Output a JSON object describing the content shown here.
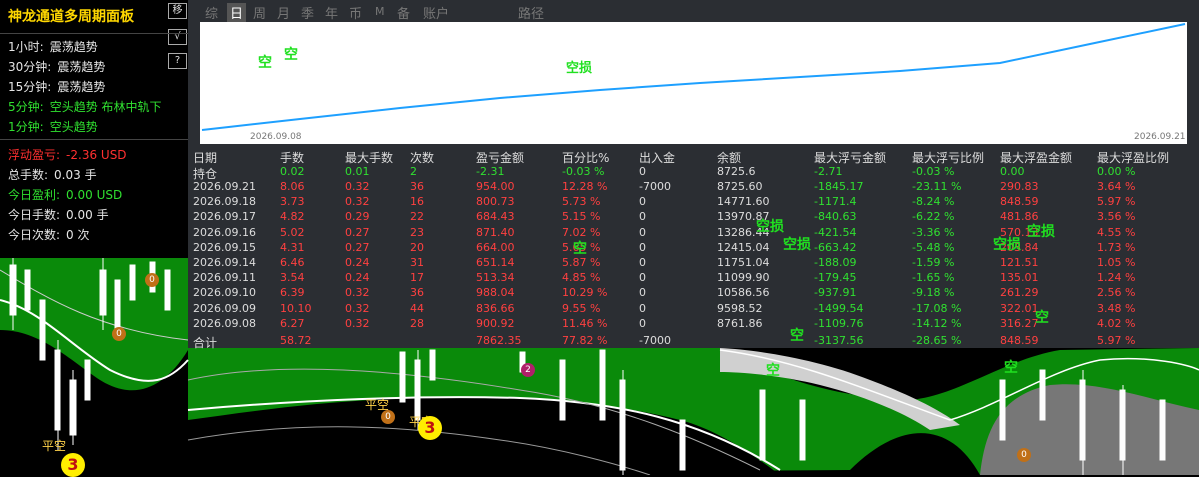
{
  "panel": {
    "title": "神龙通道多周期面板",
    "buttons": [
      "移",
      "√",
      "?"
    ],
    "periods": [
      {
        "label": "1小时:",
        "value": "震荡趋势",
        "color": "#e6e6e6"
      },
      {
        "label": "30分钟:",
        "value": "震荡趋势",
        "color": "#e6e6e6"
      },
      {
        "label": "15分钟:",
        "value": "震荡趋势",
        "color": "#e6e6e6"
      },
      {
        "label": "5分钟:",
        "value": "空头趋势  布林中轨下",
        "color": "#30e030"
      },
      {
        "label": "1分钟:",
        "value": "空头趋势",
        "color": "#30e030"
      }
    ],
    "stats": [
      {
        "label": "浮动盈亏:",
        "value": "-2.36 USD",
        "color": "#ff3030"
      },
      {
        "label": "总手数:",
        "value": "0.03 手",
        "color": "#e6e6e6"
      },
      {
        "label": "今日盈利:",
        "value": "0.00 USD",
        "color": "#30e030"
      },
      {
        "label": "今日手数:",
        "value": "0.00 手",
        "color": "#e6e6e6"
      },
      {
        "label": "今日次数:",
        "value": "0 次",
        "color": "#e6e6e6"
      }
    ]
  },
  "tabs": [
    "综",
    "日",
    "周",
    "月",
    "季",
    "年",
    "币",
    "M",
    "备",
    "账户",
    "路径"
  ],
  "active_tab": "日",
  "curve": {
    "start_date": "2026.09.08",
    "end_date": "2026.09.21",
    "label": "空损",
    "marks": [
      "空",
      "空"
    ],
    "line_color": "#1ea0ff"
  },
  "table": {
    "headers": [
      "日期",
      "手数",
      "最大手数",
      "次数",
      "盈亏金额",
      "百分比%",
      "出入金",
      "余额",
      "最大浮亏金额",
      "最大浮亏比例",
      "最大浮盈金额",
      "最大浮盈比例"
    ],
    "position_row": [
      "持仓",
      "0.02",
      "0.01",
      "2",
      "-2.31",
      "-0.03 %",
      "0",
      "8725.6",
      "-2.71",
      "-0.03 %",
      "0.00",
      "0.00 %"
    ],
    "rows": [
      [
        "2026.09.21",
        "8.06",
        "0.32",
        "36",
        "954.00",
        "12.28 %",
        "-7000",
        "8725.60",
        "-1845.17",
        "-23.11 %",
        "290.83",
        "3.64 %"
      ],
      [
        "2026.09.18",
        "3.73",
        "0.32",
        "16",
        "800.73",
        "5.73 %",
        "0",
        "14771.60",
        "-1171.4",
        "-8.24 %",
        "848.59",
        "5.97 %"
      ],
      [
        "2026.09.17",
        "4.82",
        "0.29",
        "22",
        "684.43",
        "5.15 %",
        "0",
        "13970.87",
        "-840.63",
        "-6.22 %",
        "481.86",
        "3.56 %"
      ],
      [
        "2026.09.16",
        "5.02",
        "0.27",
        "23",
        "871.40",
        "7.02 %",
        "0",
        "13286.44",
        "-421.54",
        "-3.36 %",
        "570.13",
        "4.55 %"
      ],
      [
        "2026.09.15",
        "4.31",
        "0.27",
        "20",
        "664.00",
        "5.65 %",
        "0",
        "12415.04",
        "-663.42",
        "-5.48 %",
        "203.84",
        "1.73 %"
      ],
      [
        "2026.09.14",
        "6.46",
        "0.24",
        "31",
        "651.14",
        "5.87 %",
        "0",
        "11751.04",
        "-188.09",
        "-1.59 %",
        "121.51",
        "1.05 %"
      ],
      [
        "2026.09.11",
        "3.54",
        "0.24",
        "17",
        "513.34",
        "4.85 %",
        "0",
        "11099.90",
        "-179.45",
        "-1.65 %",
        "135.01",
        "1.24 %"
      ],
      [
        "2026.09.10",
        "6.39",
        "0.32",
        "36",
        "988.04",
        "10.29 %",
        "0",
        "10586.56",
        "-937.91",
        "-9.18 %",
        "261.29",
        "2.56 %"
      ],
      [
        "2026.09.09",
        "10.10",
        "0.32",
        "44",
        "836.66",
        "9.55 %",
        "0",
        "9598.52",
        "-1499.54",
        "-17.08 %",
        "322.01",
        "3.48 %"
      ],
      [
        "2026.09.08",
        "6.27",
        "0.32",
        "28",
        "900.92",
        "11.46 %",
        "0",
        "8761.86",
        "-1109.76",
        "-14.12 %",
        "316.27",
        "4.02 %"
      ]
    ],
    "total_row": [
      "合计",
      "58.72",
      "",
      "",
      "7862.35",
      "77.82 %",
      "-7000",
      "",
      "-3137.56",
      "-28.65 %",
      "848.59",
      "5.97 %"
    ]
  },
  "table_marks": [
    "空",
    "空损",
    "空损",
    "空",
    "空损",
    "空损",
    "空",
    "空",
    "空"
  ],
  "chart_marks": [
    "平空",
    "平空",
    "平空",
    "3",
    "3",
    "0",
    "0",
    "0",
    "0",
    "2"
  ]
}
